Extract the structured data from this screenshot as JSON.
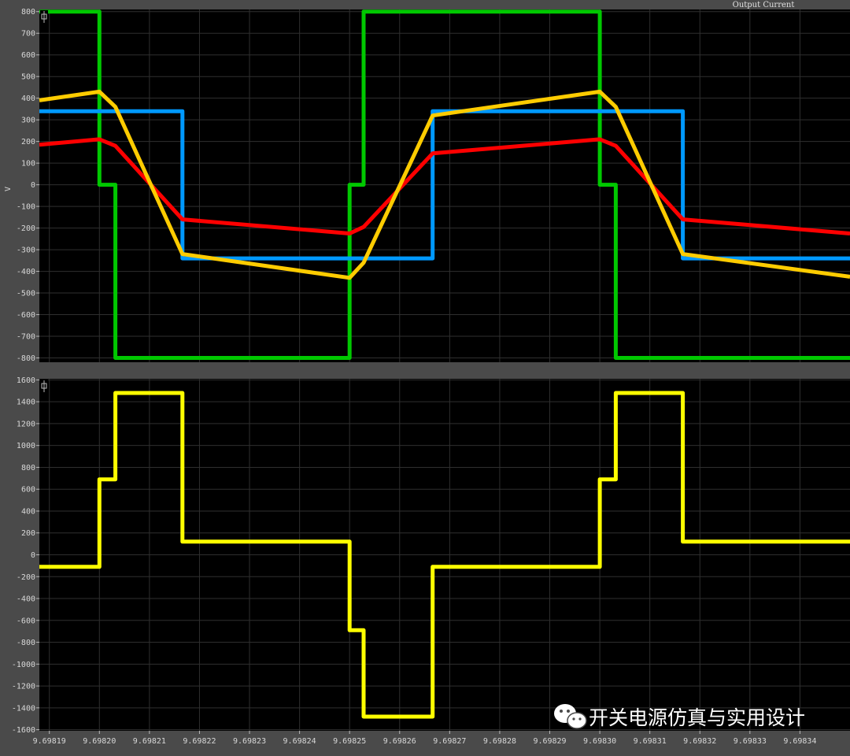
{
  "chart_data": [
    {
      "type": "line",
      "title": "",
      "ylabel": "V",
      "xlim": [
        9.698188,
        9.69835
      ],
      "ylim": [
        -820,
        810
      ],
      "yticks": [
        800,
        700,
        600,
        500,
        400,
        300,
        200,
        100,
        0,
        -100,
        -200,
        -300,
        -400,
        -500,
        -600,
        -700,
        -800
      ],
      "grid": true,
      "series": [
        {
          "color": "#00c800",
          "x": [
            9.698188,
            9.6982,
            9.6982,
            9.6982032,
            9.6982032,
            9.69825,
            9.69825,
            9.6982528,
            9.6982528,
            9.6983,
            9.6983,
            9.6983032,
            9.6983032,
            9.69835
          ],
          "y": [
            800,
            800,
            0,
            0,
            -800,
            -800,
            0,
            0,
            800,
            800,
            0,
            0,
            -800,
            -800
          ]
        },
        {
          "color": "#0099ff",
          "x": [
            9.698188,
            9.6982166,
            9.6982166,
            9.6982666,
            9.6982666,
            9.6983166,
            9.6983166,
            9.69835
          ],
          "y": [
            340,
            340,
            -340,
            -340,
            340,
            340,
            -340,
            -340
          ]
        },
        {
          "color": "#ff0000",
          "x": [
            9.698188,
            9.6982,
            9.6982032,
            9.6982166,
            9.69825,
            9.6982528,
            9.6982666,
            9.6983,
            9.6983032,
            9.6983166,
            9.69835
          ],
          "y": [
            185,
            210,
            180,
            -160,
            -225,
            -195,
            145,
            210,
            180,
            -160,
            -225
          ]
        },
        {
          "color": "#ffcc00",
          "x": [
            9.698188,
            9.6982,
            9.6982032,
            9.6982166,
            9.69825,
            9.6982528,
            9.6982666,
            9.6983,
            9.6983032,
            9.6983166,
            9.69835
          ],
          "y": [
            390,
            430,
            360,
            -320,
            -430,
            -360,
            320,
            430,
            360,
            -320,
            -425
          ]
        }
      ]
    },
    {
      "type": "line",
      "title": "Output Current",
      "xlim": [
        9.698188,
        9.69835
      ],
      "ylim": [
        -1610,
        1610
      ],
      "yticks": [
        1600,
        1400,
        1200,
        1000,
        800,
        600,
        400,
        200,
        0,
        -200,
        -400,
        -600,
        -800,
        -1000,
        -1200,
        -1400,
        -1600
      ],
      "xticks": [
        9.69819,
        9.6982,
        9.69821,
        9.69822,
        9.69823,
        9.69824,
        9.69825,
        9.69826,
        9.69827,
        9.69828,
        9.69829,
        9.6983,
        9.69831,
        9.69832,
        9.69833,
        9.69834
      ],
      "xtick_labels": [
        "9.69819",
        "9.69820",
        "9.69821",
        "9.69822",
        "9.69823",
        "9.69824",
        "9.69825",
        "9.69826",
        "9.69827",
        "9.69828",
        "9.69829",
        "9.69830",
        "9.69831",
        "9.69832",
        "9.69833",
        "9.69834"
      ],
      "grid": true,
      "series": [
        {
          "color": "#ffff00",
          "x": [
            9.698188,
            9.6982,
            9.6982,
            9.6982032,
            9.6982032,
            9.6982166,
            9.6982166,
            9.69825,
            9.69825,
            9.6982528,
            9.6982528,
            9.6982666,
            9.6982666,
            9.6983,
            9.6983,
            9.6983032,
            9.6983032,
            9.6983166,
            9.6983166,
            9.69835
          ],
          "y": [
            -110,
            -110,
            690,
            690,
            1480,
            1480,
            120,
            120,
            -690,
            -690,
            -1480,
            -1480,
            -110,
            -110,
            690,
            690,
            1480,
            1480,
            120,
            120
          ]
        }
      ]
    }
  ],
  "watermark": {
    "text": "开关电源仿真与实用设计",
    "icon": "wechat-icon"
  },
  "theme": {
    "plot_bg": "#000000",
    "frame_bg": "#4a4a4a",
    "grid": "#2f2f2f"
  }
}
